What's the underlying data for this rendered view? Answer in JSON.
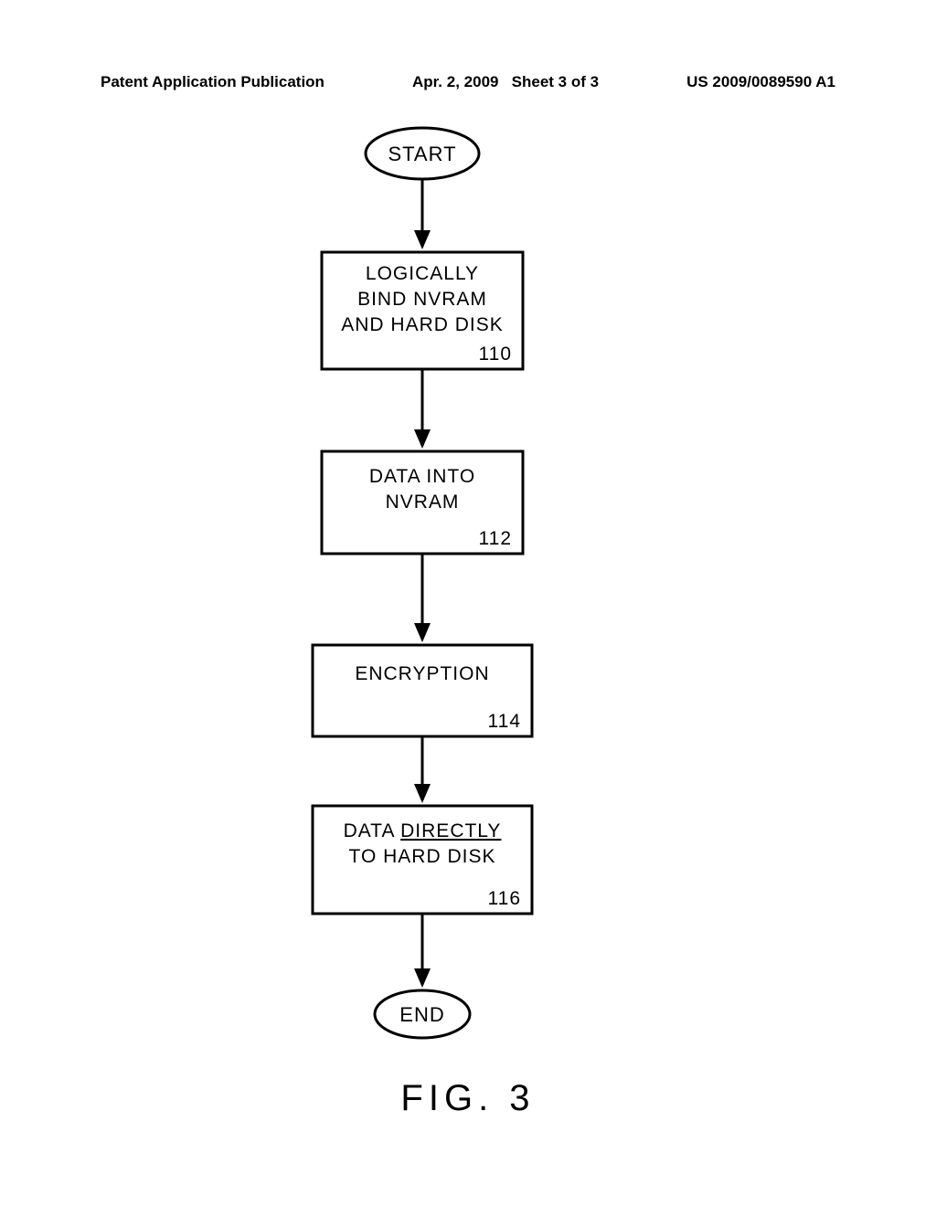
{
  "header": {
    "left": "Patent Application Publication",
    "center_date": "Apr. 2, 2009",
    "center_sheet": "Sheet 3 of 3",
    "right": "US 2009/0089590 A1"
  },
  "flow": {
    "start": "START",
    "end": "END",
    "box1": {
      "line1": "LOGICALLY",
      "line2": "BIND  NVRAM",
      "line3": "AND  HARD  DISK",
      "num": "110"
    },
    "box2": {
      "line1": "DATA  INTO",
      "line2": "NVRAM",
      "num": "112"
    },
    "box3": {
      "line1": "ENCRYPTION",
      "num": "114"
    },
    "box4": {
      "line1_a": "DATA ",
      "line1_b": "DIRECTLY",
      "line2": "TO  HARD  DISK",
      "num": "116"
    }
  },
  "caption": "FIG.  3"
}
